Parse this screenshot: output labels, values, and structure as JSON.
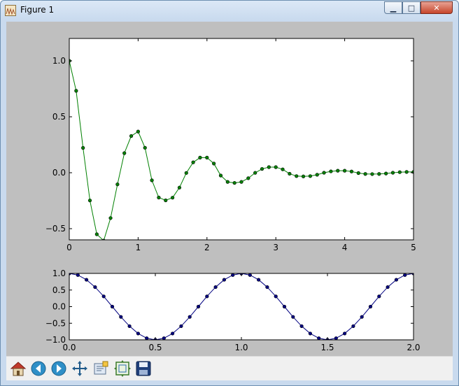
{
  "window": {
    "title": "Figure 1",
    "min_glyph": "▁",
    "max_glyph": "□",
    "close_glyph": "✕"
  },
  "toolbar": {
    "tools": [
      "home-icon",
      "back-arrow-icon",
      "forward-arrow-icon",
      "pan-icon",
      "zoom-icon",
      "subplots-icon",
      "save-icon"
    ]
  },
  "colors": {
    "figure_bg": "#bfbfbf",
    "damped_series": "#008000",
    "cos_series": "#000080"
  },
  "chart_data": [
    {
      "type": "line",
      "series": [
        {
          "x": [
            0.0,
            0.1,
            0.2,
            0.3,
            0.4,
            0.5,
            0.6,
            0.7,
            0.8,
            0.9,
            1.0,
            1.1,
            1.2,
            1.3,
            1.4,
            1.5,
            1.6,
            1.7,
            1.8,
            1.9,
            2.0,
            2.1,
            2.2,
            2.3,
            2.4,
            2.5,
            2.6,
            2.7,
            2.8,
            2.9,
            3.0,
            3.1,
            3.2,
            3.3,
            3.4,
            3.5,
            3.6,
            3.7,
            3.8,
            3.9,
            4.0,
            4.1,
            4.2,
            4.3,
            4.4,
            4.5,
            4.6,
            4.7,
            4.8,
            4.9,
            5.0
          ],
          "y": [
            1.0,
            0.732,
            0.222,
            -0.248,
            -0.55,
            -0.607,
            -0.405,
            -0.104,
            0.175,
            0.328,
            0.368,
            0.223,
            -0.068,
            -0.222,
            -0.247,
            -0.223,
            -0.133,
            -0.002,
            0.093,
            0.135,
            0.135,
            0.082,
            -0.025,
            -0.082,
            -0.091,
            -0.082,
            -0.049,
            -0.001,
            0.034,
            0.05,
            0.05,
            0.03,
            -0.009,
            -0.03,
            -0.033,
            -0.03,
            -0.018,
            0.0,
            0.012,
            0.018,
            0.018,
            0.011,
            -0.003,
            -0.011,
            -0.012,
            -0.011,
            -0.007,
            0.0,
            0.005,
            0.007,
            0.007
          ]
        }
      ],
      "xlim": [
        0,
        5
      ],
      "ylim": [
        -0.6,
        1.2
      ],
      "xticks": [
        0,
        1,
        2,
        3,
        4,
        5
      ],
      "yticks": [
        -0.5,
        0.0,
        0.5,
        1.0
      ],
      "xtick_labels": [
        "0",
        "1",
        "2",
        "3",
        "4",
        "5"
      ],
      "ytick_labels": [
        "−0.5",
        "0.0",
        "0.5",
        "1.0"
      ],
      "grid": false
    },
    {
      "type": "line",
      "series": [
        {
          "x": [
            0.0,
            0.05,
            0.1,
            0.15,
            0.2,
            0.25,
            0.3,
            0.35,
            0.4,
            0.45,
            0.5,
            0.55,
            0.6,
            0.65,
            0.7,
            0.75,
            0.8,
            0.85,
            0.9,
            0.95,
            1.0,
            1.05,
            1.1,
            1.15,
            1.2,
            1.25,
            1.3,
            1.35,
            1.4,
            1.45,
            1.5,
            1.55,
            1.6,
            1.65,
            1.7,
            1.75,
            1.8,
            1.85,
            1.9,
            1.95,
            2.0
          ],
          "y": [
            1.0,
            0.951,
            0.809,
            0.588,
            0.309,
            0.0,
            -0.309,
            -0.588,
            -0.809,
            -0.951,
            -1.0,
            -0.951,
            -0.809,
            -0.588,
            -0.309,
            0.0,
            0.309,
            0.588,
            0.809,
            0.951,
            1.0,
            0.951,
            0.809,
            0.588,
            0.309,
            0.0,
            -0.309,
            -0.588,
            -0.809,
            -0.951,
            -1.0,
            -0.951,
            -0.809,
            -0.588,
            -0.309,
            0.0,
            0.309,
            0.588,
            0.809,
            0.951,
            1.0
          ]
        }
      ],
      "xlim": [
        0,
        2
      ],
      "ylim": [
        -1,
        1
      ],
      "xticks": [
        0,
        0.5,
        1.0,
        1.5,
        2.0
      ],
      "yticks": [
        -1.0,
        -0.5,
        0.0,
        0.5,
        1.0
      ],
      "xtick_labels": [
        "0.0",
        "0.5",
        "1.0",
        "1.5",
        "2.0"
      ],
      "ytick_labels": [
        "−1.0",
        "−0.5",
        "0.0",
        "0.5",
        "1.0"
      ],
      "grid": false
    }
  ]
}
